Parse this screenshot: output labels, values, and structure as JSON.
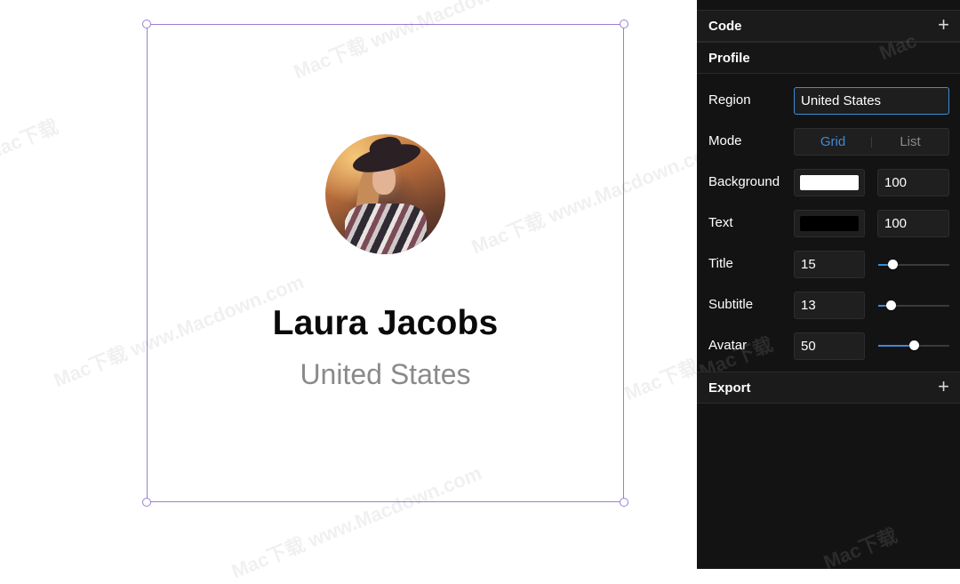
{
  "canvas": {
    "name": "Laura Jacobs",
    "region": "United States"
  },
  "panel": {
    "sections": {
      "code": "Code",
      "profile": "Profile",
      "export": "Export"
    },
    "region": {
      "label": "Region",
      "value": "United States"
    },
    "mode": {
      "label": "Mode",
      "options": [
        "Grid",
        "List"
      ],
      "selected": "Grid"
    },
    "background": {
      "label": "Background",
      "color": "#ffffff",
      "opacity": "100"
    },
    "text": {
      "label": "Text",
      "color": "#000000",
      "opacity": "100"
    },
    "title": {
      "label": "Title",
      "value": "15",
      "slider_fraction": 0.2
    },
    "subtitle": {
      "label": "Subtitle",
      "value": "13",
      "slider_fraction": 0.18
    },
    "avatar": {
      "label": "Avatar",
      "value": "50",
      "slider_fraction": 0.5
    }
  },
  "colors": {
    "accent": "#3d8bd9",
    "selection": "#9a7fd8",
    "panel_bg": "#131313"
  }
}
